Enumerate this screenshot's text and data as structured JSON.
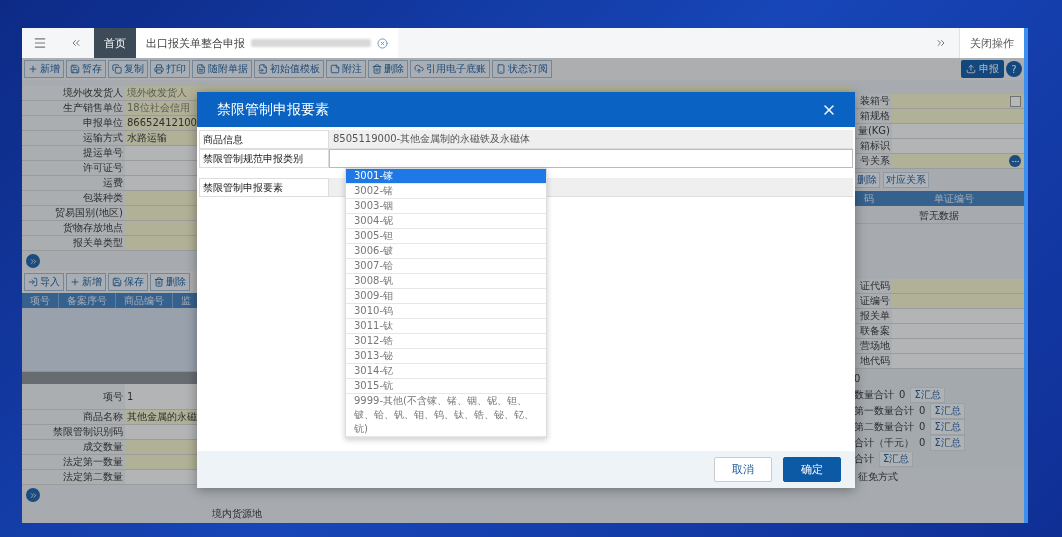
{
  "tab_bar": {
    "tabs": [
      {
        "label": "首页",
        "selected": false,
        "closable": false
      },
      {
        "label": "出口报关单整合申报",
        "selected": true,
        "closable": true
      }
    ],
    "close_all": "关闭操作"
  },
  "toolbar": {
    "buttons": [
      {
        "label": "新增"
      },
      {
        "label": "暂存"
      },
      {
        "label": "复制"
      },
      {
        "label": "打印"
      },
      {
        "label": "随附单据"
      },
      {
        "label": "初始值模板"
      },
      {
        "label": "附注"
      },
      {
        "label": "删除"
      },
      {
        "label": "引用电子底账"
      },
      {
        "label": "状态订阅"
      }
    ],
    "submit": "申报",
    "help": "?"
  },
  "header_form": {
    "rows": [
      {
        "label": "境外收发货人",
        "placeholder": "境外收发货人",
        "required": true
      },
      {
        "label": "生产销售单位",
        "placeholder": "18位社会信用",
        "required": true
      },
      {
        "label": "申报单位",
        "value": "86652412100",
        "required": true
      },
      {
        "label": "运输方式",
        "value": "水路运输",
        "required": true
      },
      {
        "label": "提运单号",
        "required": false
      },
      {
        "label": "许可证号",
        "required": false
      },
      {
        "label": "运费",
        "required": false
      },
      {
        "label": "包装种类",
        "required": true
      },
      {
        "label": "贸易国别(地区)",
        "required": true
      },
      {
        "label": "货物存放地点",
        "required": true
      },
      {
        "label": "报关单类型",
        "required": true
      }
    ]
  },
  "item_toolbar": {
    "buttons": [
      {
        "label": "导入"
      },
      {
        "label": "新增"
      },
      {
        "label": "保存"
      },
      {
        "label": "删除"
      }
    ]
  },
  "item_table": {
    "columns": [
      "项号",
      "备案序号",
      "商品编号",
      "监"
    ]
  },
  "item_form": {
    "rows": [
      {
        "label": "项号",
        "value": "1",
        "required": false
      },
      {
        "label": "商品名称",
        "value": "其他金属的永磁",
        "required": true
      },
      {
        "label": "禁限管制识别码",
        "required": false
      },
      {
        "label": "成交数量",
        "required": true
      },
      {
        "label": "法定第一数量",
        "required": true
      },
      {
        "label": "法定第二数量",
        "required": false
      }
    ],
    "bottom_label": "境内货源地"
  },
  "right_panel": {
    "rows": [
      {
        "label": "装箱号",
        "required": true,
        "kind": "checkbox"
      },
      {
        "label": "箱规格",
        "required": true,
        "kind": "text"
      },
      {
        "label": "量(KG)",
        "required": false,
        "kind": "text"
      },
      {
        "label": "箱标识",
        "required": false,
        "kind": "text"
      },
      {
        "label": "号关系",
        "required": true,
        "kind": "more"
      }
    ],
    "actions": [
      "删除",
      "对应关系"
    ],
    "table": {
      "columns": [
        "码",
        "单证编号"
      ],
      "empty": "暂无数据"
    },
    "lower_rows": [
      {
        "label": "证代码",
        "required": true
      },
      {
        "label": "证编号",
        "required": true
      },
      {
        "label": "报关单",
        "required": false
      },
      {
        "label": "联备案",
        "required": false
      },
      {
        "label": "营场地",
        "required": false
      },
      {
        "label": "地代码",
        "required": false
      }
    ],
    "totals": [
      {
        "value": "0"
      },
      {
        "label": "数量合计",
        "value": "0",
        "button": "Σ汇总"
      },
      {
        "label": "第一数量合计",
        "value": "0",
        "button": "Σ汇总"
      },
      {
        "label": "第二数量合计",
        "value": "0",
        "button": "Σ汇总"
      },
      {
        "label": "合计（千元）",
        "value": "0",
        "button": "Σ汇总"
      },
      {
        "label": "合计",
        "button": "Σ汇总"
      }
    ],
    "bottom_label": "征免方式"
  },
  "modal": {
    "title": "禁限管制申报要素",
    "fields": [
      {
        "label": "商品信息",
        "kind": "readonly",
        "value": "8505119000-其他金属制的永磁铁及永磁体"
      },
      {
        "label": "禁限管制规范申报类别",
        "kind": "select"
      },
      {
        "label": "禁限管制申报要素",
        "kind": "readonly"
      }
    ],
    "options": [
      {
        "label": "3001-镓",
        "selected": true
      },
      {
        "label": "3002-锗",
        "selected": false
      },
      {
        "label": "3003-铟",
        "selected": false
      },
      {
        "label": "3004-铌",
        "selected": false
      },
      {
        "label": "3005-钽",
        "selected": false
      },
      {
        "label": "3006-铍",
        "selected": false
      },
      {
        "label": "3007-铪",
        "selected": false
      },
      {
        "label": "3008-钒",
        "selected": false
      },
      {
        "label": "3009-钼",
        "selected": false
      },
      {
        "label": "3010-钨",
        "selected": false
      },
      {
        "label": "3011-钛",
        "selected": false
      },
      {
        "label": "3012-锆",
        "selected": false
      },
      {
        "label": "3013-铋",
        "selected": false
      },
      {
        "label": "3014-钇",
        "selected": false
      },
      {
        "label": "3015-钪",
        "selected": false
      },
      {
        "label": "9999-其他(不含镓、锗、铟、铌、钽、铍、铪、钒、钼、钨、钛、锆、铋、钇、钪)",
        "selected": false
      }
    ],
    "buttons": [
      {
        "label": "取消",
        "primary": false
      },
      {
        "label": "确定",
        "primary": true
      }
    ]
  }
}
